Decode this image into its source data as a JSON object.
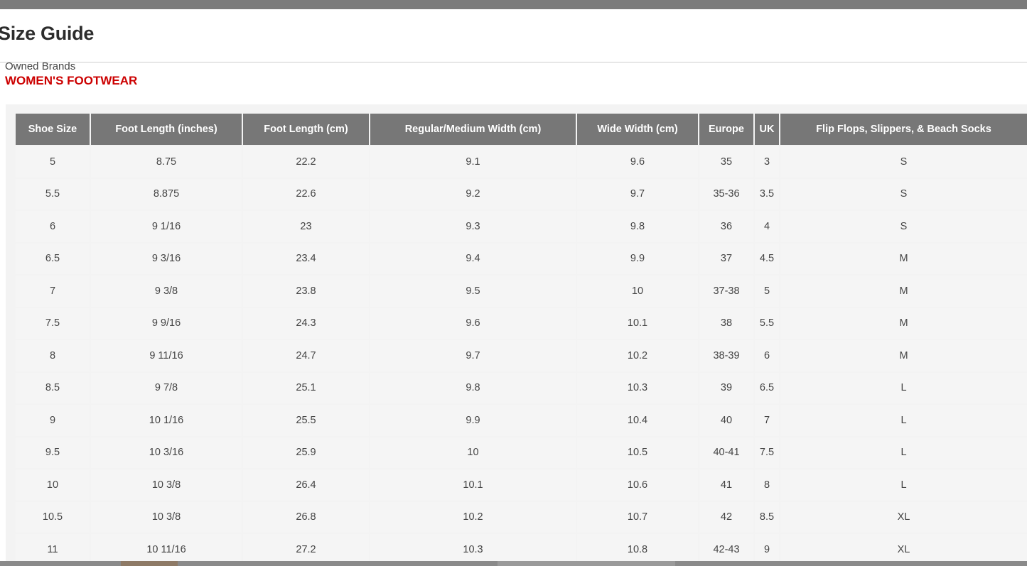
{
  "modal": {
    "title": "Size Guide",
    "brand_group": "Owned Brands",
    "category": "WOMEN'S FOOTWEAR"
  },
  "colors": {
    "category_red": "#cc0000",
    "header_gray": "#777777",
    "cell_bg": "#f5f5f5"
  },
  "table": {
    "headers": [
      "Shoe Size",
      "Foot Length (inches)",
      "Foot Length (cm)",
      "Regular/Medium Width (cm)",
      "Wide Width (cm)",
      "Europe",
      "UK",
      "Flip Flops, Slippers, & Beach Socks"
    ],
    "rows": [
      [
        "5",
        "8.75",
        "22.2",
        "9.1",
        "9.6",
        "35",
        "3",
        "S"
      ],
      [
        "5.5",
        "8.875",
        "22.6",
        "9.2",
        "9.7",
        "35-36",
        "3.5",
        "S"
      ],
      [
        "6",
        "9 1/16",
        "23",
        "9.3",
        "9.8",
        "36",
        "4",
        "S"
      ],
      [
        "6.5",
        "9 3/16",
        "23.4",
        "9.4",
        "9.9",
        "37",
        "4.5",
        "M"
      ],
      [
        "7",
        "9 3/8",
        "23.8",
        "9.5",
        "10",
        "37-38",
        "5",
        "M"
      ],
      [
        "7.5",
        "9 9/16",
        "24.3",
        "9.6",
        "10.1",
        "38",
        "5.5",
        "M"
      ],
      [
        "8",
        "9 11/16",
        "24.7",
        "9.7",
        "10.2",
        "38-39",
        "6",
        "M"
      ],
      [
        "8.5",
        "9 7/8",
        "25.1",
        "9.8",
        "10.3",
        "39",
        "6.5",
        "L"
      ],
      [
        "9",
        "10 1/16",
        "25.5",
        "9.9",
        "10.4",
        "40",
        "7",
        "L"
      ],
      [
        "9.5",
        "10 3/16",
        "25.9",
        "10",
        "10.5",
        "40-41",
        "7.5",
        "L"
      ],
      [
        "10",
        "10 3/8",
        "26.4",
        "10.1",
        "10.6",
        "41",
        "8",
        "L"
      ],
      [
        "10.5",
        "10 3/8",
        "26.8",
        "10.2",
        "10.7",
        "42",
        "8.5",
        "XL"
      ],
      [
        "11",
        "10 11/16",
        "27.2",
        "10.3",
        "10.8",
        "42-43",
        "9",
        "XL"
      ]
    ]
  }
}
